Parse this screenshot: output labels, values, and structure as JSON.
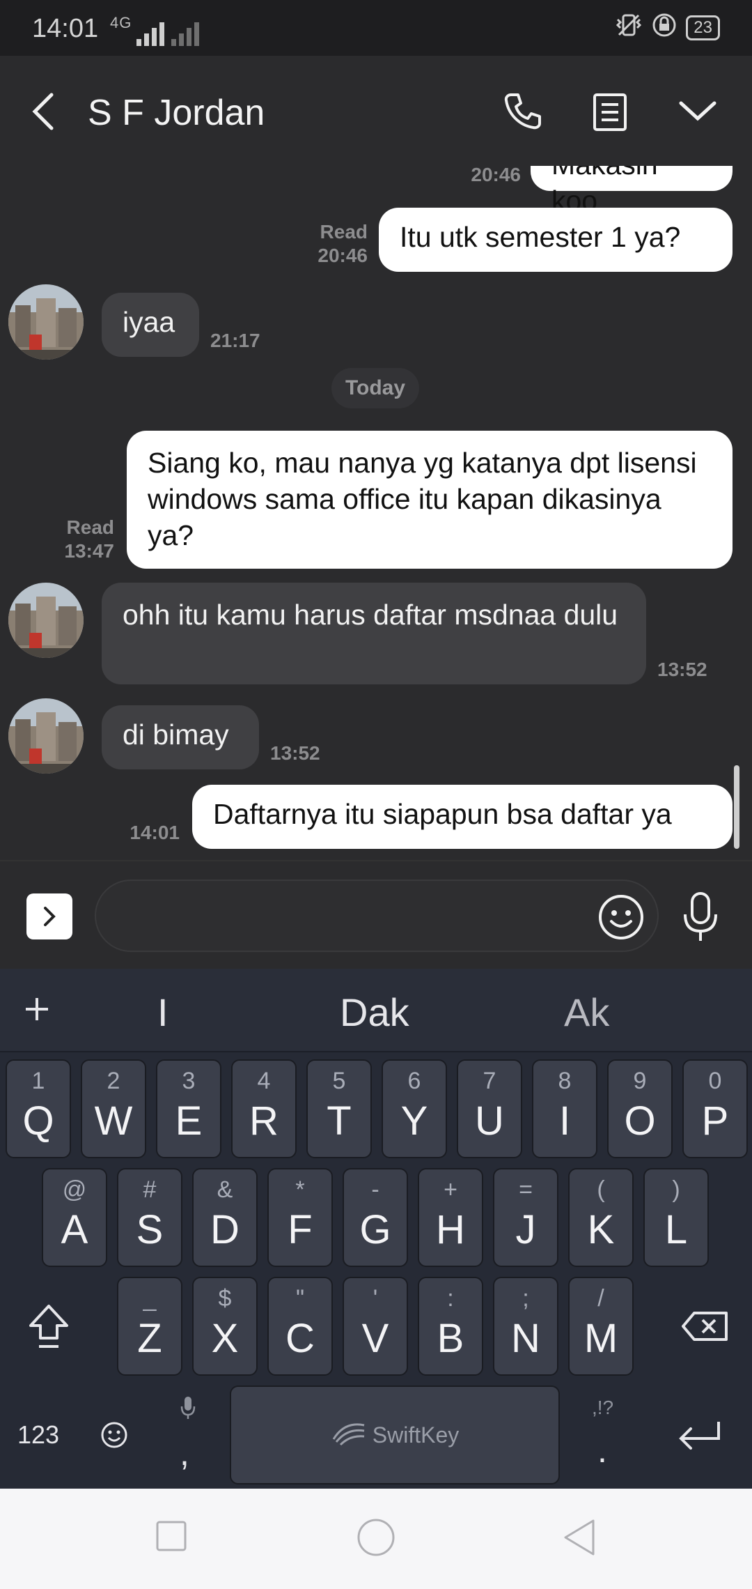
{
  "status_bar": {
    "time": "14:01",
    "network": "4G",
    "battery": "23"
  },
  "header": {
    "contact_name": "S F Jordan"
  },
  "chat": {
    "day_separator": "Today",
    "messages": [
      {
        "dir": "out",
        "text": "Makasih koo",
        "read": "",
        "time": "20:46"
      },
      {
        "dir": "out",
        "text": "Itu utk semester 1 ya?",
        "read": "Read",
        "time": "20:46"
      },
      {
        "dir": "in",
        "text": "iyaa",
        "time": "21:17"
      },
      {
        "dir": "out",
        "text": "Siang ko, mau nanya yg katanya dpt lisensi windows sama office itu kapan dikasinya ya?",
        "read": "Read",
        "time": "13:47"
      },
      {
        "dir": "in",
        "text": "ohh itu kamu harus daftar msdnaa dulu",
        "time": "13:52"
      },
      {
        "dir": "in",
        "text": "di bimay",
        "time": "13:52"
      },
      {
        "dir": "out",
        "text": "Daftarnya itu siapapun bsa daftar ya",
        "read": "",
        "time": "14:01"
      }
    ]
  },
  "input": {
    "placeholder": ""
  },
  "keyboard": {
    "suggestions": [
      "I",
      "Dak",
      "Ak"
    ],
    "row1": [
      {
        "main": "Q",
        "sub": "1"
      },
      {
        "main": "W",
        "sub": "2"
      },
      {
        "main": "E",
        "sub": "3"
      },
      {
        "main": "R",
        "sub": "4"
      },
      {
        "main": "T",
        "sub": "5"
      },
      {
        "main": "Y",
        "sub": "6"
      },
      {
        "main": "U",
        "sub": "7"
      },
      {
        "main": "I",
        "sub": "8"
      },
      {
        "main": "O",
        "sub": "9"
      },
      {
        "main": "P",
        "sub": "0"
      }
    ],
    "row2": [
      {
        "main": "A",
        "sub": "@"
      },
      {
        "main": "S",
        "sub": "#"
      },
      {
        "main": "D",
        "sub": "&"
      },
      {
        "main": "F",
        "sub": "*"
      },
      {
        "main": "G",
        "sub": "-"
      },
      {
        "main": "H",
        "sub": "+"
      },
      {
        "main": "J",
        "sub": "="
      },
      {
        "main": "K",
        "sub": "("
      },
      {
        "main": "L",
        "sub": ")"
      }
    ],
    "row3": [
      {
        "main": "Z",
        "sub": "_"
      },
      {
        "main": "X",
        "sub": "$"
      },
      {
        "main": "C",
        "sub": "\""
      },
      {
        "main": "V",
        "sub": "'"
      },
      {
        "main": "B",
        "sub": ":"
      },
      {
        "main": "N",
        "sub": ";"
      },
      {
        "main": "M",
        "sub": "/"
      }
    ],
    "numbers_key": "123",
    "comma_key": ",",
    "period_key": ".",
    "period_sub": ",!?",
    "space_label": "SwiftKey"
  }
}
